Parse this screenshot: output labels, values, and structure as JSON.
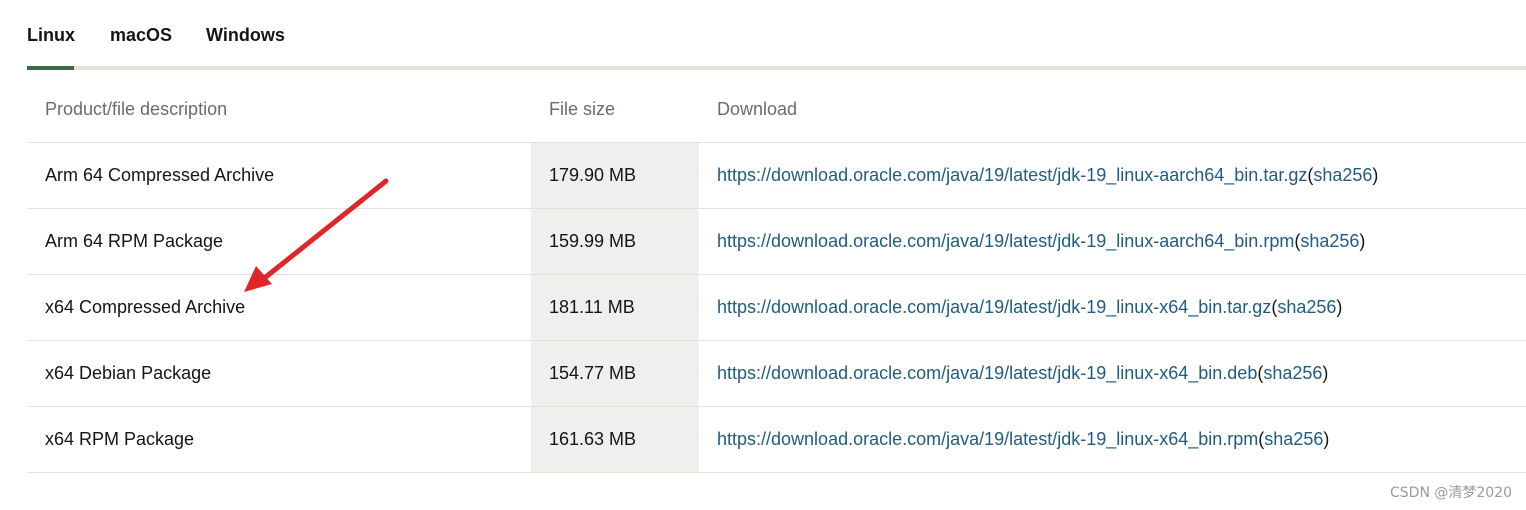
{
  "tabs": [
    {
      "label": "Linux",
      "active": true
    },
    {
      "label": "macOS",
      "active": false
    },
    {
      "label": "Windows",
      "active": false
    }
  ],
  "table": {
    "headers": {
      "description": "Product/file description",
      "size": "File size",
      "download": "Download"
    },
    "rows": [
      {
        "description": "Arm 64 Compressed Archive",
        "size": "179.90 MB",
        "url": "https://download.oracle.com/java/19/latest/jdk-19_linux-aarch64_bin.tar.gz",
        "checksum": "sha256"
      },
      {
        "description": "Arm 64 RPM Package",
        "size": "159.99 MB",
        "url": "https://download.oracle.com/java/19/latest/jdk-19_linux-aarch64_bin.rpm",
        "checksum": "sha256"
      },
      {
        "description": "x64 Compressed Archive",
        "size": "181.11 MB",
        "url": "https://download.oracle.com/java/19/latest/jdk-19_linux-x64_bin.tar.gz",
        "checksum": "sha256"
      },
      {
        "description": "x64 Debian Package",
        "size": "154.77 MB",
        "url": "https://download.oracle.com/java/19/latest/jdk-19_linux-x64_bin.deb",
        "checksum": "sha256"
      },
      {
        "description": "x64 RPM Package",
        "size": "161.63 MB",
        "url": "https://download.oracle.com/java/19/latest/jdk-19_linux-x64_bin.rpm",
        "checksum": "sha256"
      }
    ]
  },
  "punctuation": {
    "open": " ( ",
    "close": ")"
  },
  "watermark": "CSDN @清梦2020",
  "colors": {
    "accent_tab": "#3a6b48",
    "link": "#1f5c80",
    "annotation_arrow": "#e0262b",
    "size_column_bg": "#f1efed"
  }
}
